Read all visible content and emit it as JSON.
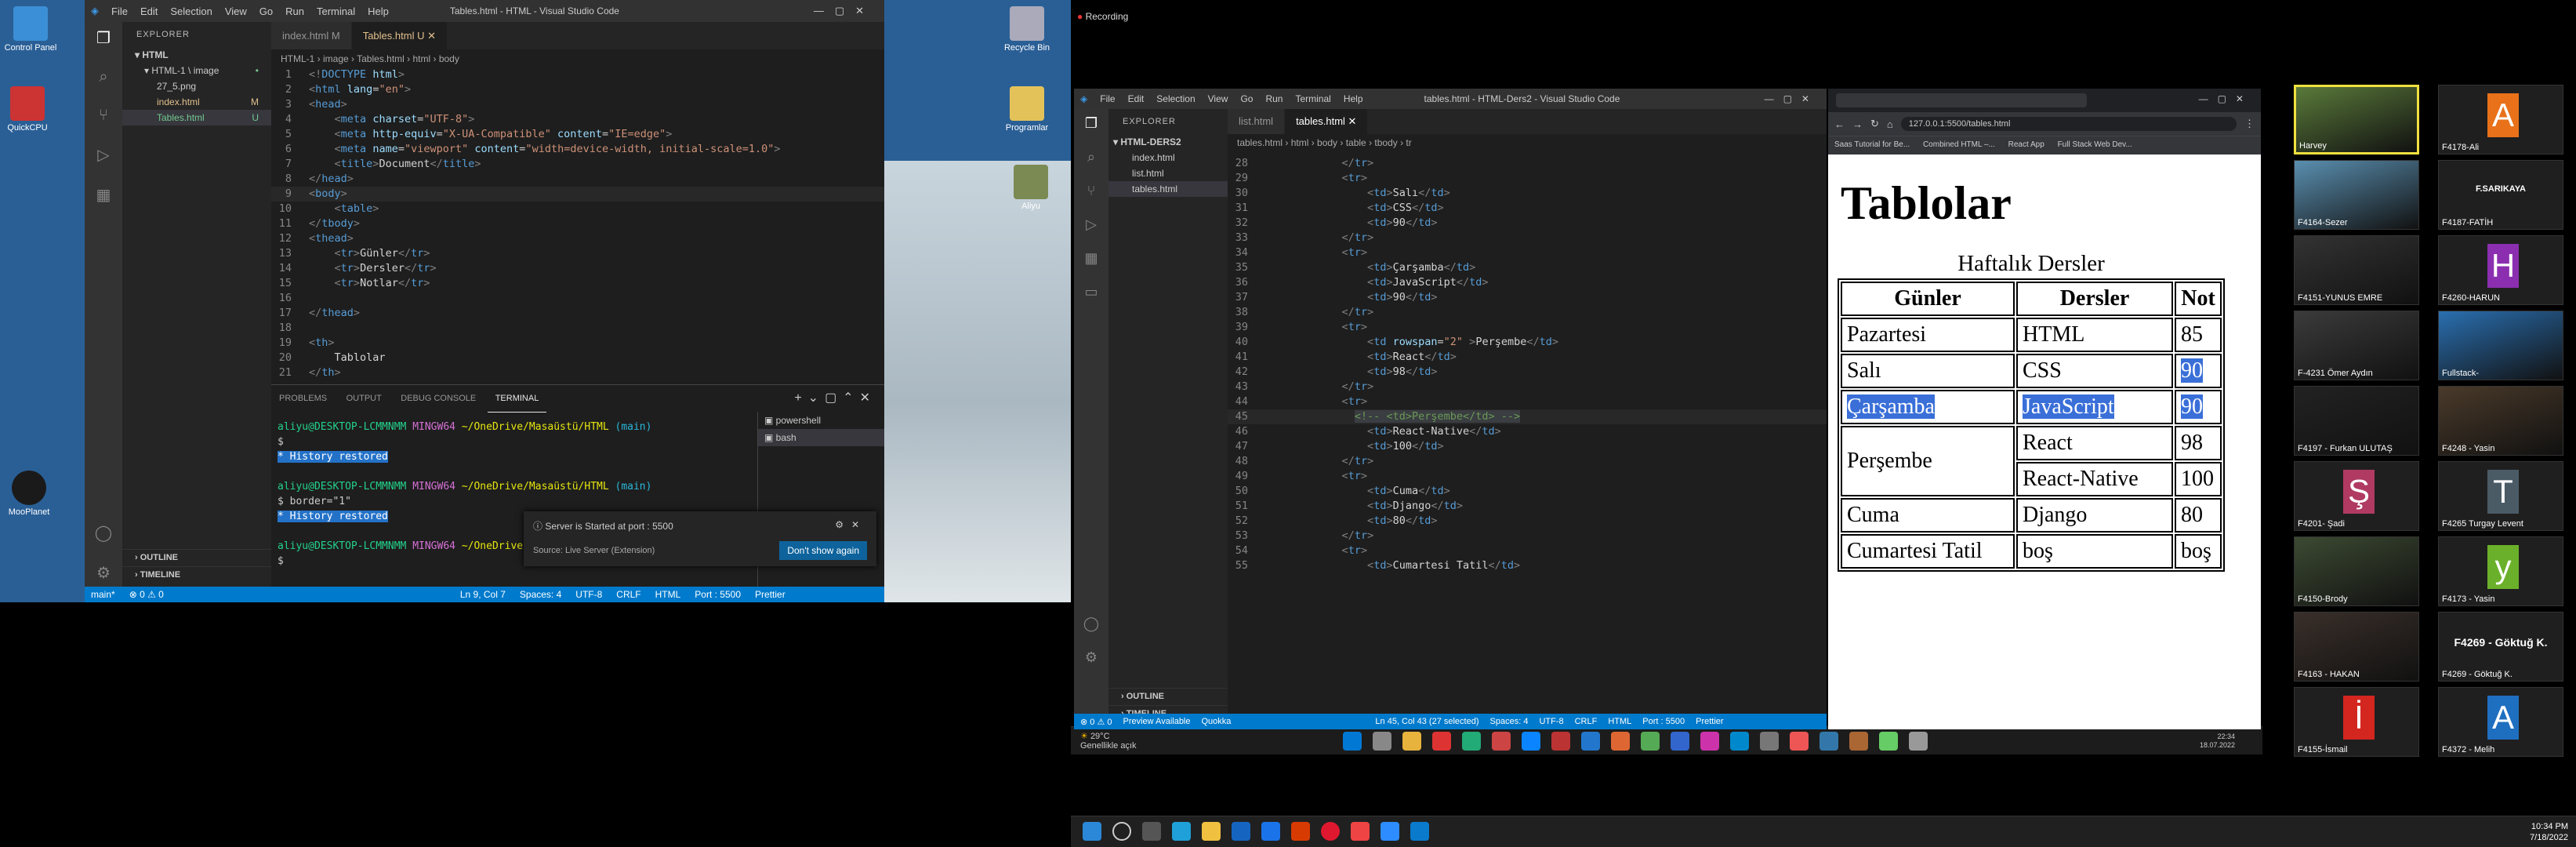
{
  "recording": "Recording",
  "left_desktop": {
    "icons": [
      {
        "label": "Control Panel"
      },
      {
        "label": "QuickCPU"
      },
      {
        "label": "Recycle Bin"
      },
      {
        "label": "Programlar"
      },
      {
        "label": "Aliyu"
      },
      {
        "label": "MooPlanet"
      }
    ]
  },
  "vs1": {
    "menu": [
      "File",
      "Edit",
      "Selection",
      "View",
      "Go",
      "Run",
      "Terminal",
      "Help"
    ],
    "title": "Tables.html - HTML - Visual Studio Code",
    "explorer_label": "EXPLORER",
    "tree": [
      {
        "label": "HTML",
        "badge": ""
      },
      {
        "label": "HTML-1 \\ image",
        "badge": "•"
      },
      {
        "label": "27_5.png",
        "badge": ""
      },
      {
        "label": "index.html",
        "badge": "M"
      },
      {
        "label": "Tables.html",
        "badge": "U"
      }
    ],
    "outline": "OUTLINE",
    "timeline": "TIMELINE",
    "tabs": [
      {
        "label": "index.html M"
      },
      {
        "label": "Tables.html U"
      }
    ],
    "breadcrumb": "HTML-1 › image › Tables.html › html › body",
    "code": [
      {
        "n": "1",
        "html": "<span class='t-br'>&lt;!</span><span class='t-tag'>DOCTYPE</span> <span class='t-attr'>html</span><span class='t-br'>&gt;</span>"
      },
      {
        "n": "2",
        "html": "<span class='t-br'>&lt;</span><span class='t-tag'>html</span> <span class='t-attr'>lang</span>=<span class='t-str'>\"en\"</span><span class='t-br'>&gt;</span>"
      },
      {
        "n": "3",
        "html": "<span class='t-br'>&lt;</span><span class='t-tag'>head</span><span class='t-br'>&gt;</span>"
      },
      {
        "n": "4",
        "html": "    <span class='t-br'>&lt;</span><span class='t-tag'>meta</span> <span class='t-attr'>charset</span>=<span class='t-str'>\"UTF-8\"</span><span class='t-br'>&gt;</span>"
      },
      {
        "n": "5",
        "html": "    <span class='t-br'>&lt;</span><span class='t-tag'>meta</span> <span class='t-attr'>http-equiv</span>=<span class='t-str'>\"X-UA-Compatible\"</span> <span class='t-attr'>content</span>=<span class='t-str'>\"IE=edge\"</span><span class='t-br'>&gt;</span>"
      },
      {
        "n": "6",
        "html": "    <span class='t-br'>&lt;</span><span class='t-tag'>meta</span> <span class='t-attr'>name</span>=<span class='t-str'>\"viewport\"</span> <span class='t-attr'>content</span>=<span class='t-str'>\"width=device-width, initial-scale=1.0\"</span><span class='t-br'>&gt;</span>"
      },
      {
        "n": "7",
        "html": "    <span class='t-br'>&lt;</span><span class='t-tag'>title</span><span class='t-br'>&gt;</span><span class='t-txt'>Document</span><span class='t-br'>&lt;/</span><span class='t-tag'>title</span><span class='t-br'>&gt;</span>"
      },
      {
        "n": "8",
        "html": "<span class='t-br'>&lt;/</span><span class='t-tag'>head</span><span class='t-br'>&gt;</span>"
      },
      {
        "n": "9",
        "html": "<span class='t-br'>&lt;</span><span class='t-tag'>body</span><span class='t-br'>&gt;</span>"
      },
      {
        "n": "10",
        "html": "    <span class='t-br'>&lt;</span><span class='t-tag'>table</span><span class='t-br'>&gt;</span>"
      },
      {
        "n": "11",
        "html": "<span class='t-br'>&lt;/</span><span class='t-tag'>tbody</span><span class='t-br'>&gt;</span>"
      },
      {
        "n": "12",
        "html": "<span class='t-br'>&lt;</span><span class='t-tag'>thead</span><span class='t-br'>&gt;</span>"
      },
      {
        "n": "13",
        "html": "    <span class='t-br'>&lt;</span><span class='t-tag'>tr</span><span class='t-br'>&gt;</span><span class='t-txt'>Günler</span><span class='t-br'>&lt;/</span><span class='t-tag'>tr</span><span class='t-br'>&gt;</span>"
      },
      {
        "n": "14",
        "html": "    <span class='t-br'>&lt;</span><span class='t-tag'>tr</span><span class='t-br'>&gt;</span><span class='t-txt'>Dersler</span><span class='t-br'>&lt;/</span><span class='t-tag'>tr</span><span class='t-br'>&gt;</span>"
      },
      {
        "n": "15",
        "html": "    <span class='t-br'>&lt;</span><span class='t-tag'>tr</span><span class='t-br'>&gt;</span><span class='t-txt'>Notlar</span><span class='t-br'>&lt;/</span><span class='t-tag'>tr</span><span class='t-br'>&gt;</span>"
      },
      {
        "n": "16",
        "html": ""
      },
      {
        "n": "17",
        "html": "<span class='t-br'>&lt;/</span><span class='t-tag'>thead</span><span class='t-br'>&gt;</span>"
      },
      {
        "n": "18",
        "html": ""
      },
      {
        "n": "19",
        "html": "<span class='t-br'>&lt;</span><span class='t-tag'>th</span><span class='t-br'>&gt;</span>"
      },
      {
        "n": "20",
        "html": "    <span class='t-txt'>Tablolar</span>"
      },
      {
        "n": "21",
        "html": "<span class='t-br'>&lt;/</span><span class='t-tag'>th</span><span class='t-br'>&gt;</span>"
      }
    ],
    "panel_tabs": [
      "PROBLEMS",
      "OUTPUT",
      "DEBUG CONSOLE",
      "TERMINAL"
    ],
    "terminal": [
      {
        "prompt": "aliyu@DESKTOP-LCMMNMM",
        "sys": "MINGW64",
        "path": "~/OneDrive/Masaüstü/HTML",
        "branch": "(main)"
      },
      {
        "line": "$"
      },
      {
        "history": "History restored"
      },
      {
        "prompt": "aliyu@DESKTOP-LCMMNMM",
        "sys": "MINGW64",
        "path": "~/OneDrive/Masaüstü/HTML",
        "branch": "(main)"
      },
      {
        "line": "$ border=\"1\""
      },
      {
        "history": "History restored"
      },
      {
        "prompt": "aliyu@DESKTOP-LCMMNMM",
        "sys": "MINGW64",
        "path": "~/OneDrive/Masaüstü/HTML",
        "branch": "(main)"
      },
      {
        "line": "$"
      }
    ],
    "terminals": [
      "powershell",
      "bash"
    ],
    "notification": {
      "title": "Server is Started at port : 5500",
      "source": "Source: Live Server (Extension)",
      "button": "Don't show again"
    },
    "status": {
      "branch": "main*",
      "errors": "⊗ 0 ⚠ 0",
      "pos": "Ln 9, Col 7",
      "spaces": "Spaces: 4",
      "enc": "UTF-8",
      "eol": "CRLF",
      "lang": "HTML",
      "port": "Port : 5500",
      "prettier": "Prettier"
    }
  },
  "vs2": {
    "menu": [
      "File",
      "Edit",
      "Selection",
      "View",
      "Go",
      "Run",
      "Terminal",
      "Help"
    ],
    "title": "tables.html - HTML-Ders2 - Visual Studio Code",
    "explorer_label": "EXPLORER",
    "tree": [
      {
        "label": "HTML-DERS2"
      },
      {
        "label": "index.html"
      },
      {
        "label": "list.html"
      },
      {
        "label": "tables.html"
      }
    ],
    "outline": "OUTLINE",
    "timeline": "TIMELINE",
    "tabs": [
      {
        "label": "list.html"
      },
      {
        "label": "tables.html"
      }
    ],
    "breadcrumb": "tables.html › html › body › table › tbody › tr",
    "code": [
      {
        "n": "28",
        "html": "            <span class='t-br'>&lt;/</span><span class='t-tag'>tr</span><span class='t-br'>&gt;</span>"
      },
      {
        "n": "29",
        "html": "            <span class='t-br'>&lt;</span><span class='t-tag'>tr</span><span class='t-br'>&gt;</span>"
      },
      {
        "n": "30",
        "html": "                <span class='t-br'>&lt;</span><span class='t-tag'>td</span><span class='t-br'>&gt;</span><span class='t-txt'>Salı</span><span class='t-br'>&lt;/</span><span class='t-tag'>td</span><span class='t-br'>&gt;</span>"
      },
      {
        "n": "31",
        "html": "                <span class='t-br'>&lt;</span><span class='t-tag'>td</span><span class='t-br'>&gt;</span><span class='t-txt'>CSS</span><span class='t-br'>&lt;/</span><span class='t-tag'>td</span><span class='t-br'>&gt;</span>"
      },
      {
        "n": "32",
        "html": "                <span class='t-br'>&lt;</span><span class='t-tag'>td</span><span class='t-br'>&gt;</span><span class='t-txt'>90</span><span class='t-br'>&lt;/</span><span class='t-tag'>td</span><span class='t-br'>&gt;</span>"
      },
      {
        "n": "33",
        "html": "            <span class='t-br'>&lt;/</span><span class='t-tag'>tr</span><span class='t-br'>&gt;</span>"
      },
      {
        "n": "34",
        "html": "            <span class='t-br'>&lt;</span><span class='t-tag'>tr</span><span class='t-br'>&gt;</span>"
      },
      {
        "n": "35",
        "html": "                <span class='t-br'>&lt;</span><span class='t-tag'>td</span><span class='t-br'>&gt;</span><span class='t-txt'>Çarşamba</span><span class='t-br'>&lt;/</span><span class='t-tag'>td</span><span class='t-br'>&gt;</span>"
      },
      {
        "n": "36",
        "html": "                <span class='t-br'>&lt;</span><span class='t-tag'>td</span><span class='t-br'>&gt;</span><span class='t-txt'>JavaScript</span><span class='t-br'>&lt;/</span><span class='t-tag'>td</span><span class='t-br'>&gt;</span>"
      },
      {
        "n": "37",
        "html": "                <span class='t-br'>&lt;</span><span class='t-tag'>td</span><span class='t-br'>&gt;</span><span class='t-txt'>90</span><span class='t-br'>&lt;/</span><span class='t-tag'>td</span><span class='t-br'>&gt;</span>"
      },
      {
        "n": "38",
        "html": "            <span class='t-br'>&lt;/</span><span class='t-tag'>tr</span><span class='t-br'>&gt;</span>"
      },
      {
        "n": "39",
        "html": "            <span class='t-br'>&lt;</span><span class='t-tag'>tr</span><span class='t-br'>&gt;</span>"
      },
      {
        "n": "40",
        "html": "                <span class='t-br'>&lt;</span><span class='t-tag'>td</span> <span class='t-attr'>rowspan</span>=<span class='t-str'>\"2\"</span> <span class='t-br'>&gt;</span><span class='t-txt'>Perşembe</span><span class='t-br'>&lt;/</span><span class='t-tag'>td</span><span class='t-br'>&gt;</span>"
      },
      {
        "n": "41",
        "html": "                <span class='t-br'>&lt;</span><span class='t-tag'>td</span><span class='t-br'>&gt;</span><span class='t-txt'>React</span><span class='t-br'>&lt;/</span><span class='t-tag'>td</span><span class='t-br'>&gt;</span>"
      },
      {
        "n": "42",
        "html": "                <span class='t-br'>&lt;</span><span class='t-tag'>td</span><span class='t-br'>&gt;</span><span class='t-txt'>98</span><span class='t-br'>&lt;/</span><span class='t-tag'>td</span><span class='t-br'>&gt;</span>"
      },
      {
        "n": "43",
        "html": "            <span class='t-br'>&lt;/</span><span class='t-tag'>tr</span><span class='t-br'>&gt;</span>"
      },
      {
        "n": "44",
        "html": "            <span class='t-br'>&lt;</span><span class='t-tag'>tr</span><span class='t-br'>&gt;</span>"
      },
      {
        "n": "45",
        "html": "              <span class='t-cm' style='background:#3a3d41'>&lt;!-- &lt;td&gt;Perşembe&lt;/td&gt; --&gt;</span>"
      },
      {
        "n": "46",
        "html": "                <span class='t-br'>&lt;</span><span class='t-tag'>td</span><span class='t-br'>&gt;</span><span class='t-txt'>React-Native</span><span class='t-br'>&lt;/</span><span class='t-tag'>td</span><span class='t-br'>&gt;</span>"
      },
      {
        "n": "47",
        "html": "                <span class='t-br'>&lt;</span><span class='t-tag'>td</span><span class='t-br'>&gt;</span><span class='t-txt'>100</span><span class='t-br'>&lt;/</span><span class='t-tag'>td</span><span class='t-br'>&gt;</span>"
      },
      {
        "n": "48",
        "html": "            <span class='t-br'>&lt;/</span><span class='t-tag'>tr</span><span class='t-br'>&gt;</span>"
      },
      {
        "n": "49",
        "html": "            <span class='t-br'>&lt;</span><span class='t-tag'>tr</span><span class='t-br'>&gt;</span>"
      },
      {
        "n": "50",
        "html": "                <span class='t-br'>&lt;</span><span class='t-tag'>td</span><span class='t-br'>&gt;</span><span class='t-txt'>Cuma</span><span class='t-br'>&lt;/</span><span class='t-tag'>td</span><span class='t-br'>&gt;</span>"
      },
      {
        "n": "51",
        "html": "                <span class='t-br'>&lt;</span><span class='t-tag'>td</span><span class='t-br'>&gt;</span><span class='t-txt'>Django</span><span class='t-br'>&lt;/</span><span class='t-tag'>td</span><span class='t-br'>&gt;</span>"
      },
      {
        "n": "52",
        "html": "                <span class='t-br'>&lt;</span><span class='t-tag'>td</span><span class='t-br'>&gt;</span><span class='t-txt'>80</span><span class='t-br'>&lt;/</span><span class='t-tag'>td</span><span class='t-br'>&gt;</span>"
      },
      {
        "n": "53",
        "html": "            <span class='t-br'>&lt;/</span><span class='t-tag'>tr</span><span class='t-br'>&gt;</span>"
      },
      {
        "n": "54",
        "html": "            <span class='t-br'>&lt;</span><span class='t-tag'>tr</span><span class='t-br'>&gt;</span>"
      },
      {
        "n": "55",
        "html": "                <span class='t-br'>&lt;</span><span class='t-tag'>td</span><span class='t-br'>&gt;</span><span class='t-txt'>Cumartesi Tatil</span><span class='t-br'>&lt;/</span><span class='t-tag'>td</span><span class='t-br'>&gt;</span>"
      }
    ],
    "status": {
      "left": "⊗ 0 ⚠ 0",
      "preview": "Preview Available",
      "quokka": "Quokka",
      "pos": "Ln 45, Col 43 (27 selected)",
      "spaces": "Spaces: 4",
      "enc": "UTF-8",
      "eol": "CRLF",
      "lang": "HTML",
      "port": "Port : 5500",
      "prettier": "Prettier"
    }
  },
  "browser": {
    "url": "127.0.0.1:5500/tables.html",
    "bookmarks": [
      "Saas Tutorial for Be...",
      "Combined HTML –...",
      "React App",
      "Full Stack Web Dev..."
    ],
    "heading": "Tablolar",
    "caption": "Haftalık Dersler",
    "headers": [
      "Günler",
      "Dersler",
      "Not"
    ],
    "rows": [
      [
        "Pazartesi",
        "HTML",
        "85"
      ],
      [
        "Salı",
        "CSS",
        "90"
      ],
      [
        "Çarşamba",
        "JavaScript",
        "90"
      ],
      [
        "Perşembe",
        "React",
        "98"
      ],
      [
        "",
        "React-Native",
        "100"
      ],
      [
        "Cuma",
        "Django",
        "80"
      ],
      [
        "Cumartesi Tatil",
        "boş",
        "boş"
      ]
    ]
  },
  "participants": [
    {
      "name": "Harvey",
      "letter": "",
      "color": "#5a7a3a"
    },
    {
      "name": "F4178-Ali",
      "letter": "A",
      "color": "#e8711a"
    },
    {
      "name": "F4164-Sezer",
      "letter": "",
      "color": "#5a8fb0"
    },
    {
      "name": "F4187-FATİH",
      "letter": "F.SARIKAYA",
      "color": "#1f1f1f"
    },
    {
      "name": "F4151-YUNUS EMRE",
      "letter": "",
      "color": "#333"
    },
    {
      "name": "F4260-HARUN",
      "letter": "H",
      "color": "#8b2fb0"
    },
    {
      "name": "F-4231 Ömer Aydın",
      "letter": "",
      "color": "#3b3b3b"
    },
    {
      "name": "Fullstack-",
      "letter": "",
      "color": "#2a6fb0"
    },
    {
      "name": "F4197 - Furkan ULUTAŞ",
      "letter": "",
      "color": "#222"
    },
    {
      "name": "F4248 - Yasin",
      "letter": "",
      "color": "#4a3a2a"
    },
    {
      "name": "F4201- Şadi",
      "letter": "Ş",
      "color": "#b03a62"
    },
    {
      "name": "F4265 Turgay Levent",
      "letter": "T",
      "color": "#4a5b66"
    },
    {
      "name": "F4150-Brody",
      "letter": "",
      "color": "#3c4a32"
    },
    {
      "name": "F4173 - Yasin",
      "letter": "y",
      "color": "#6bb02a"
    },
    {
      "name": "F4163 - HAKAN",
      "letter": "",
      "color": "#3a2f2a"
    },
    {
      "name": "F4269 - Göktuğ K.",
      "letter": "F4269 - Göktuğ K.",
      "color": "#1f1f1f"
    },
    {
      "name": "F4155-İsmail",
      "letter": "İ",
      "color": "#d3261f"
    },
    {
      "name": "F4372 - Melih",
      "letter": "A",
      "color": "#1f6fc0"
    }
  ],
  "weather": {
    "temp": "29°C",
    "desc": "Genellikle açık"
  },
  "small_clock": {
    "time": "22:34",
    "date": "18.07.2022"
  },
  "clock": {
    "time": "10:34 PM",
    "date": "7/18/2022"
  }
}
